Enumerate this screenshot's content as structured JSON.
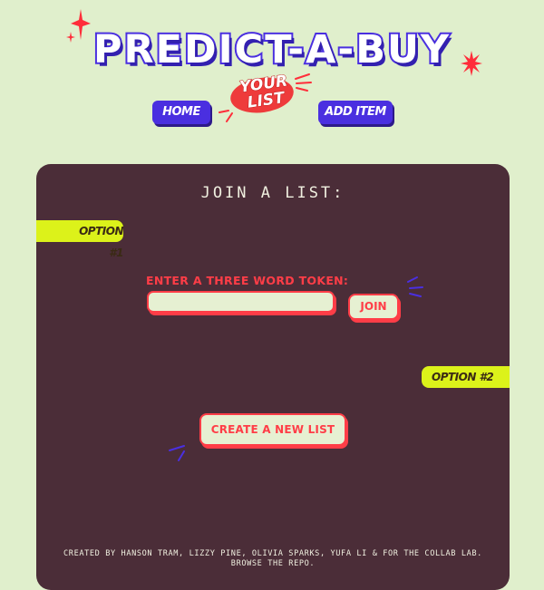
{
  "brand": {
    "logo_text": "PREDICT-A-BUY"
  },
  "nav": {
    "home_label": "HOME",
    "your_list_line1": "YOUR",
    "your_list_line2": "LIST",
    "add_item_label": "ADD ITEM"
  },
  "join": {
    "title": "JOIN A LIST:",
    "option1_label": "OPTION #1",
    "token_label": "ENTER A THREE WORD TOKEN:",
    "token_value": "",
    "token_placeholder": "",
    "join_button_label": "JOIN",
    "option2_label": "OPTION #2",
    "create_button_label": "CREATE A NEW LIST"
  },
  "footer": {
    "credits": "CREATED BY HANSON TRAM, LIZZY PINE, OLIVIA SPARKS, YUFA LI & FOR THE COLLAB LAB.",
    "browse_repo": "BROWSE THE REPO."
  },
  "colors": {
    "background": "#e0efcc",
    "panel": "#4b2d38",
    "primary_blue": "#4a2fe0",
    "accent_red": "#ff3d47",
    "tag_yellow": "#dcf21a"
  }
}
